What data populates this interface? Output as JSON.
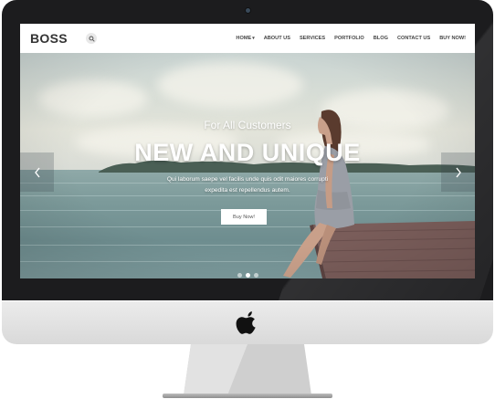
{
  "site": {
    "logo": "BOSS",
    "search_icon": "search-icon"
  },
  "nav": {
    "items": [
      {
        "label": "HOME",
        "has_dropdown": true
      },
      {
        "label": "ABOUT US"
      },
      {
        "label": "SERVICES"
      },
      {
        "label": "PORTFOLIO"
      },
      {
        "label": "BLOG"
      },
      {
        "label": "CONTACT US"
      },
      {
        "label": "BUY NOW!"
      }
    ],
    "dropdown_caret": "▾"
  },
  "hero": {
    "subtitle": "For All Customers",
    "title": "NEW AND UNIQUE",
    "text_line1": "Qui laborum saepe vel facilis unde quis odit maiores corrupti",
    "text_line2": "expedita est repellendus autem.",
    "button_label": "Buy Now!",
    "prev_icon": "chevron-left-icon",
    "next_icon": "chevron-right-icon",
    "slide_count": 3,
    "active_slide": 1
  },
  "colors": {
    "header_bg": "#ffffff",
    "nav_text": "#444444",
    "hero_text": "#ffffff",
    "monitor_bezel": "#1c1c1e",
    "monitor_chin": "#e0e0e0"
  }
}
